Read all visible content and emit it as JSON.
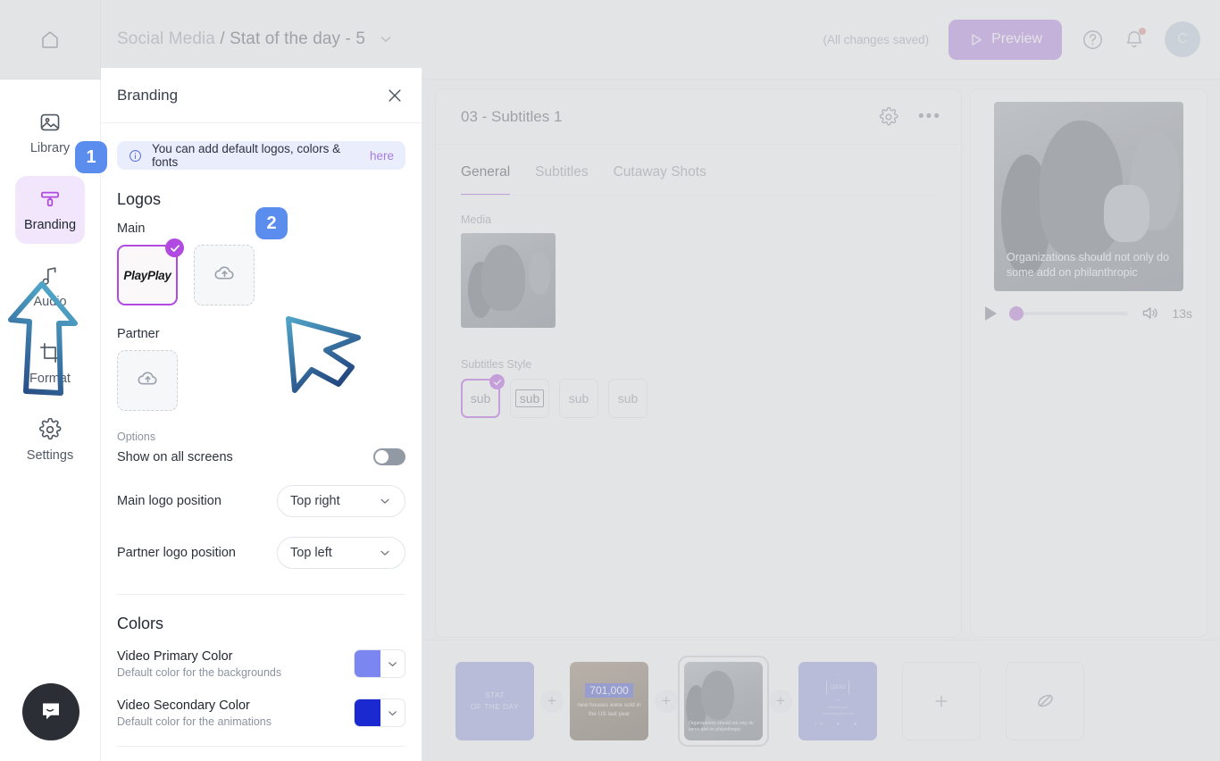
{
  "topbar": {
    "home_icon": "home-icon",
    "breadcrumb_project": "Social Media",
    "breadcrumb_separator": "/",
    "breadcrumb_current": "Stat of the day - 5",
    "saved_status": "(All changes saved)",
    "preview_label": "Preview",
    "help_icon": "question-circle-icon",
    "bell_icon": "notification-bell-icon",
    "avatar_initial": "C"
  },
  "rail": {
    "items": [
      {
        "label": "Library",
        "icon": "image-library-icon",
        "active": false
      },
      {
        "label": "Branding",
        "icon": "paint-roller-icon",
        "active": true
      },
      {
        "label": "Audio",
        "icon": "music-note-icon",
        "active": false
      },
      {
        "label": "Format",
        "icon": "crop-format-icon",
        "active": false
      },
      {
        "label": "Settings",
        "icon": "gear-icon",
        "active": false
      }
    ],
    "chat_icon": "intercom-chat-icon"
  },
  "panel": {
    "title": "Branding",
    "close_icon": "close-icon",
    "notice": {
      "icon": "info-circle-icon",
      "text": "You can add default logos, colors & fonts",
      "link_text": "here"
    },
    "logos": {
      "section_title": "Logos",
      "main_label": "Main",
      "main_logo_name": "PlayPlay",
      "main_selected": true,
      "upload_icon": "cloud-upload-icon",
      "partner_label": "Partner"
    },
    "options": {
      "section_label": "Options",
      "show_all_screens_label": "Show on all screens",
      "show_all_screens_on": false,
      "main_logo_position_label": "Main logo position",
      "main_logo_position_value": "Top right",
      "partner_logo_position_label": "Partner logo position",
      "partner_logo_position_value": "Top left"
    },
    "colors": {
      "section_title": "Colors",
      "primary_label": "Video Primary Color",
      "primary_sub": "Default color for the backgrounds",
      "primary_hex": "#7b86f0",
      "secondary_label": "Video Secondary Color",
      "secondary_sub": "Default color for the animations",
      "secondary_hex": "#1a2ad0"
    }
  },
  "editor": {
    "slide_title": "03 - Subtitles 1",
    "gear_icon": "gear-icon",
    "more_icon": "more-horizontal-icon",
    "tabs": [
      {
        "label": "General",
        "active": true
      },
      {
        "label": "Subtitles",
        "active": false
      },
      {
        "label": "Cutaway Shots",
        "active": false
      }
    ],
    "media_label": "Media",
    "subtitles_style_label": "Subtitles Style",
    "subtitle_styles": [
      {
        "label": "sub",
        "selected": true,
        "variant": "plain"
      },
      {
        "label": "sub",
        "selected": false,
        "variant": "boxed"
      },
      {
        "label": "sub",
        "selected": false,
        "variant": "plain"
      },
      {
        "label": "sub",
        "selected": false,
        "variant": "plain"
      }
    ]
  },
  "preview": {
    "caption": "Organizations should not only do some add on philanthropic",
    "play_icon": "play-icon",
    "volume_icon": "volume-icon",
    "duration": "13s",
    "progress_percent": 0
  },
  "timeline": {
    "slides": [
      {
        "kind": "title",
        "line1": "STAT",
        "line2": "OF THE DAY",
        "selected": false
      },
      {
        "kind": "stat",
        "number": "701,000",
        "caption": "new houses were sold in the US last year",
        "selected": false
      },
      {
        "kind": "video",
        "caption": "Organizations should not only do some add on philanthropic",
        "selected": true
      },
      {
        "kind": "logo",
        "logo_text": "LOGO",
        "sub1": "playplay.com",
        "sub2": "hello@playplay.com",
        "selected": false
      }
    ],
    "add_icon": "plus-icon",
    "hidden_icon": "eye-off-icon",
    "separator_plus": "+"
  },
  "annotations": {
    "badges": [
      {
        "number": "1",
        "target": "branding-rail-item"
      },
      {
        "number": "2",
        "target": "main-logo-upload"
      }
    ],
    "arrow_up_color": "#2b5a9e",
    "cursor_color": "#2f5fa0"
  }
}
